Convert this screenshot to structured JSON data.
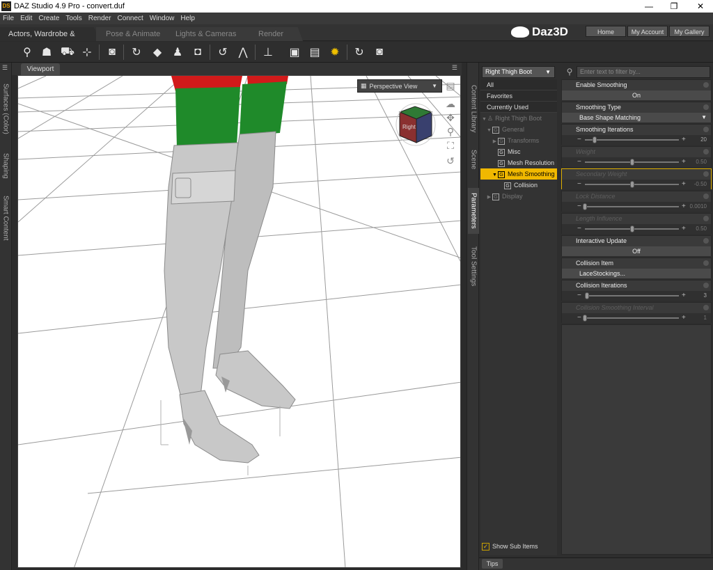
{
  "window": {
    "title": "DAZ Studio 4.9 Pro - convert.duf",
    "logo": "DS",
    "controls": [
      "—",
      "❐",
      "✕"
    ]
  },
  "menu": [
    "File",
    "Edit",
    "Create",
    "Tools",
    "Render",
    "Connect",
    "Window",
    "Help"
  ],
  "room_tabs": [
    "Actors, Wardrobe & Props",
    "Pose & Animate",
    "Lights & Cameras",
    "Render"
  ],
  "brand": "Daz3D",
  "top_buttons": [
    "Home",
    "My Account",
    "My Gallery"
  ],
  "toolbar_icons": [
    "figure-add-icon",
    "figure-pose-icon",
    "figure-prop-icon",
    "figure-transform-icon",
    "camera-icon",
    "camera-rotate-icon",
    "spotlight-icon",
    "figure-light-icon",
    "camera-light-icon",
    "node-rotate-icon",
    "joint-editor-icon",
    "node-transform-icon",
    "scene-camera-icon",
    "scene-render-icon",
    "light-bulb-icon",
    "render-settings-icon",
    "camera-render-icon"
  ],
  "left_tabs": [
    "Surfaces (Color)",
    "Shaping",
    "Smart Content"
  ],
  "viewport": {
    "tab": "Viewport",
    "view_mode": "Perspective View",
    "cube_label": "Right"
  },
  "middle_tabs": [
    "Content Library",
    "Scene",
    "Parameters",
    "Tool Settings"
  ],
  "parameters": {
    "node": "Right Thigh Boot",
    "filter_placeholder": "Enter text to filter by...",
    "tree_top": [
      "All",
      "Favorites",
      "Currently Used"
    ],
    "tree": [
      {
        "label": "Right Thigh Boot",
        "level": 0,
        "arrow": "▼",
        "dim": true,
        "icon": "figure-icon"
      },
      {
        "label": "General",
        "level": 1,
        "arrow": "▼",
        "dim": true,
        "icon": "G"
      },
      {
        "label": "Transforms",
        "level": 2,
        "arrow": "▶",
        "dim": true,
        "icon": "G"
      },
      {
        "label": "Misc",
        "level": 2,
        "arrow": "",
        "dim": false,
        "icon": "G"
      },
      {
        "label": "Mesh Resolution",
        "level": 2,
        "arrow": "",
        "dim": false,
        "icon": "G"
      },
      {
        "label": "Mesh Smoothing",
        "level": 2,
        "arrow": "▼",
        "dim": false,
        "selected": true,
        "icon": "G"
      },
      {
        "label": "Collision",
        "level": 3,
        "arrow": "",
        "dim": false,
        "icon": "G"
      },
      {
        "label": "Display",
        "level": 1,
        "arrow": "▶",
        "dim": true,
        "icon": "G"
      }
    ],
    "show_sub_items": "Show Sub Items",
    "tips": "Tips",
    "params": [
      {
        "label": "Enable Smoothing",
        "kind": "button",
        "value": "On"
      },
      {
        "label": "Smoothing Type",
        "kind": "dropdown",
        "value": "Base Shape Matching"
      },
      {
        "label": "Smoothing Iterations",
        "kind": "slider",
        "value": "20",
        "fraction": 0.1
      },
      {
        "label": "Weight",
        "kind": "slider",
        "value": "0.50",
        "fraction": 0.5,
        "disabled": true
      },
      {
        "label": "Secondary Weight",
        "kind": "slider",
        "value": "-0.50",
        "fraction": 0.5,
        "disabled": true,
        "highlight": true
      },
      {
        "label": "Lock Distance",
        "kind": "slider",
        "value": "0.0010",
        "fraction": 0.0,
        "disabled": true
      },
      {
        "label": "Length Influence",
        "kind": "slider",
        "value": "0.50",
        "fraction": 0.5,
        "disabled": true
      },
      {
        "label": "Interactive Update",
        "kind": "button",
        "value": "Off"
      },
      {
        "label": "Collision Item",
        "kind": "dropdown",
        "value": "LaceStockings..."
      },
      {
        "label": "Collision Iterations",
        "kind": "slider",
        "value": "3",
        "fraction": 0.02
      },
      {
        "label": "Collision Smoothing Interval",
        "kind": "slider",
        "value": "1",
        "fraction": 0.0,
        "disabled": true
      }
    ]
  },
  "colors": {
    "accent": "#f0b800",
    "panel": "#3a3a3a",
    "boot": "#c8c8c8",
    "stocking_green": "#1f8a2a",
    "stocking_red": "#d11a1a"
  }
}
